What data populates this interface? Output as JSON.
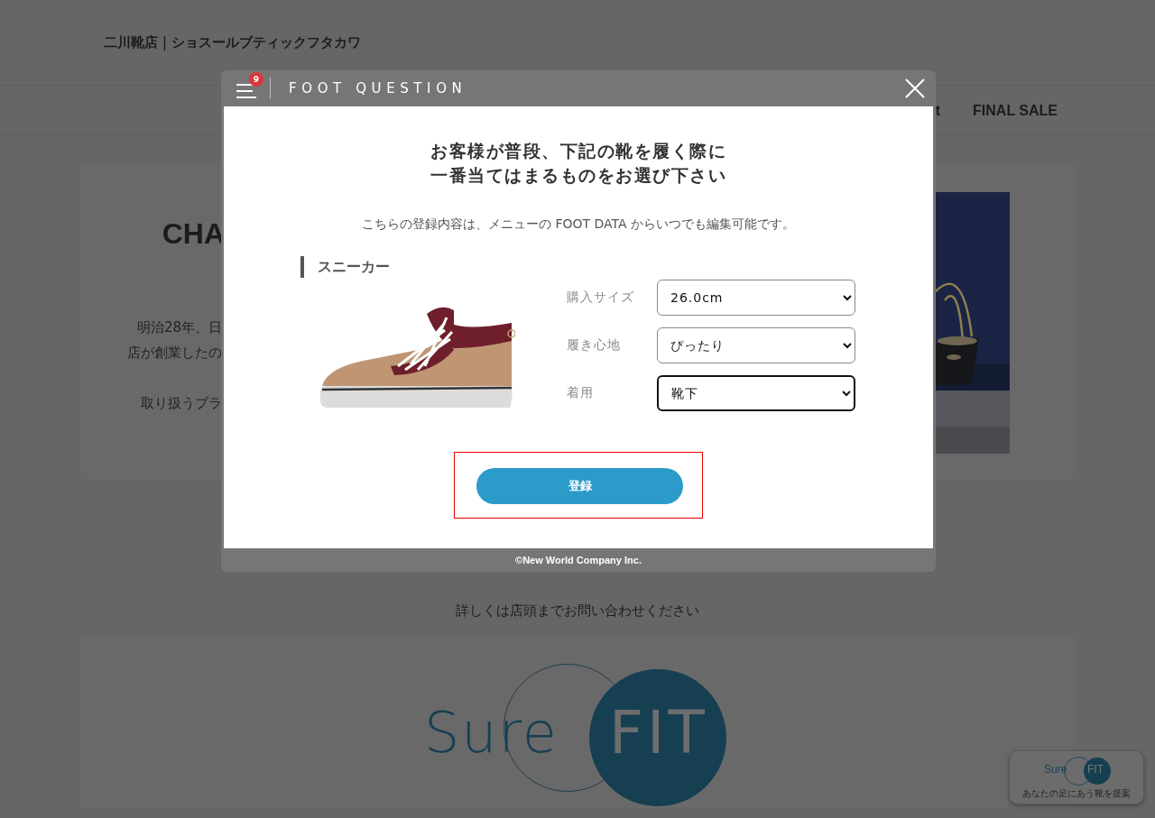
{
  "site_title": "二川靴店｜ショスールブティックフタカワ",
  "nav": [
    {
      "label": "t"
    },
    {
      "label": "FINAL SALE"
    }
  ],
  "intro": {
    "heading": "CHA",
    "lines": [
      "明治28年、日",
      "店が創業したの",
      "取り扱うブラ"
    ]
  },
  "contact_note": "詳しくは店頭までお問い合わせください",
  "logo": {
    "word": "Sure",
    "badge": "FIT"
  },
  "float_widget": {
    "logo_word": "Sure",
    "logo_badge": "FIT",
    "caption": "あなたの足にあう靴を提案"
  },
  "modal": {
    "menu_badge": "9",
    "title": "FOOT QUESTION",
    "heading_lines": [
      "お客様が普段、下記の靴を履く際に",
      "一番当てはまるものをお選び下さい"
    ],
    "note": "こちらの登録内容は、メニューの FOOT DATA からいつでも編集可能です。",
    "section": "スニーカー",
    "fields": [
      {
        "label": "購入サイズ",
        "value": "26.0cm",
        "focused": false
      },
      {
        "label": "履き心地",
        "value": "ぴったり",
        "focused": false
      },
      {
        "label": "着用",
        "value": "靴下",
        "focused": true
      }
    ],
    "submit": {
      "label": "登録",
      "highlighted": true
    },
    "footer": "©New World Company Inc."
  }
}
